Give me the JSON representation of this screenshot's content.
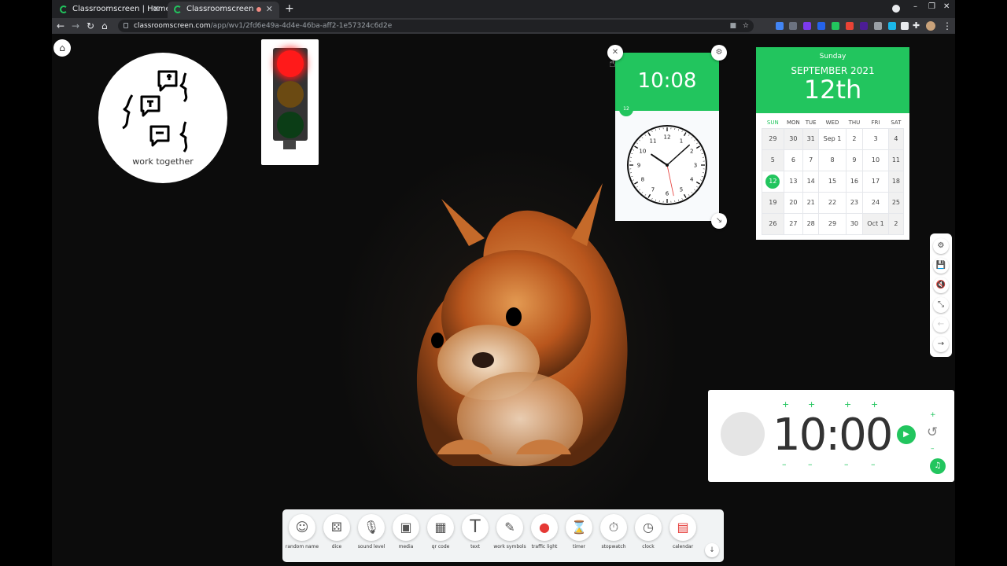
{
  "browser": {
    "tabs": [
      {
        "title": "Classroomscreen | Home",
        "close": "✕"
      },
      {
        "title": "Classroomscreen",
        "close": "✕"
      }
    ],
    "new_tab": "+",
    "window_controls": {
      "minimize": "–",
      "restore": "❐",
      "close": "✕"
    },
    "nav": {
      "back": "←",
      "forward": "→",
      "reload": "↻",
      "home": "⌂"
    },
    "url_host": "classroomscreen.com",
    "url_path": "/app/wv1/2fd6e49a-4d4e-46ba-aff2-1e57324c6d2e",
    "extension_colors": [
      "#4285f4",
      "#6b7280",
      "#7c3aed",
      "#2563eb",
      "#22c55e",
      "#ea4335",
      "#4c1d95",
      "#9aa0a6",
      "#1ab7ea",
      "#e8eaed"
    ]
  },
  "page": {
    "home_icon": "⌂",
    "work_symbols": {
      "caption": "work together"
    },
    "traffic_light": {
      "active": "red",
      "colors": {
        "red": "#ff1a1a",
        "amber": "#6b4a12",
        "green": "#0b3d16"
      }
    },
    "clock": {
      "digital_time": "10:08",
      "badge": "12",
      "numbers": [
        "12",
        "1",
        "2",
        "3",
        "4",
        "5",
        "6",
        "7",
        "8",
        "9",
        "10",
        "11"
      ],
      "hour": 10,
      "minute": 8,
      "second": 28
    },
    "calendar": {
      "weekday": "Sunday",
      "month_year": "SEPTEMBER 2021",
      "day": "12th",
      "day_headers": [
        "SUN",
        "MON",
        "TUE",
        "WED",
        "THU",
        "FRI",
        "SAT"
      ],
      "weeks": [
        [
          "29",
          "30",
          "31",
          "Sep 1",
          "2",
          "3",
          "4"
        ],
        [
          "5",
          "6",
          "7",
          "8",
          "9",
          "10",
          "11"
        ],
        [
          "12",
          "13",
          "14",
          "15",
          "16",
          "17",
          "18"
        ],
        [
          "19",
          "20",
          "21",
          "22",
          "23",
          "24",
          "25"
        ],
        [
          "26",
          "27",
          "28",
          "29",
          "30",
          "Oct 1",
          "2"
        ]
      ],
      "today": "12"
    },
    "side_menu": [
      "⚙",
      "💾",
      "🔇",
      "⤡",
      "←",
      "→"
    ],
    "timer": {
      "time": "10:00",
      "plus": "+",
      "minus": "–",
      "play": "▶",
      "reset": "↺",
      "music": "♫"
    },
    "dock": [
      {
        "label": "random name",
        "icon": "random-name-icon"
      },
      {
        "label": "dice",
        "icon": "dice-icon"
      },
      {
        "label": "sound level",
        "icon": "microphone-icon"
      },
      {
        "label": "media",
        "icon": "media-icon"
      },
      {
        "label": "qr code",
        "icon": "qr-code-icon"
      },
      {
        "label": "text",
        "icon": "text-icon"
      },
      {
        "label": "work symbols",
        "icon": "work-symbols-icon"
      },
      {
        "label": "traffic light",
        "icon": "traffic-light-icon"
      },
      {
        "label": "timer",
        "icon": "hourglass-icon"
      },
      {
        "label": "stopwatch",
        "icon": "stopwatch-icon"
      },
      {
        "label": "clock",
        "icon": "clock-icon"
      },
      {
        "label": "calendar",
        "icon": "calendar-icon"
      }
    ],
    "dock_toggle": "↓",
    "accent": "#22c55e"
  }
}
